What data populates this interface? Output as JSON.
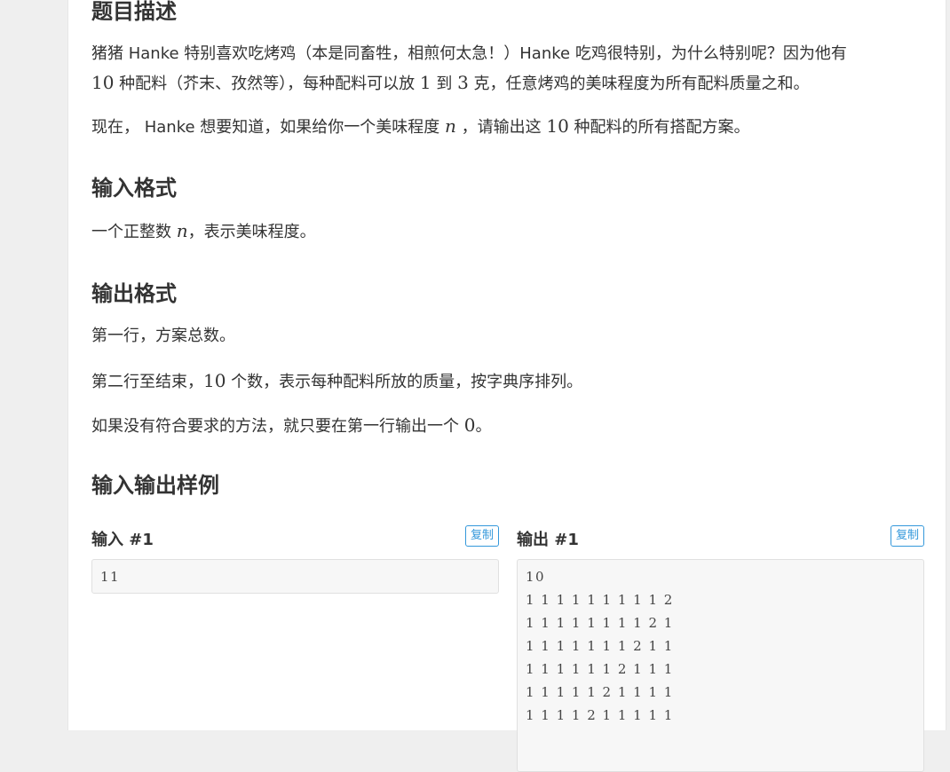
{
  "sections": {
    "description_title": "题目描述",
    "input_format_title": "输入格式",
    "output_format_title": "输出格式",
    "samples_title": "输入输出样例"
  },
  "description": {
    "p1_a": "猪猪 Hanke 特别喜欢吃烤鸡（本是同畜牲，相煎何太急！）Hanke 吃鸡很特别，为什么特别呢？因为他有",
    "p1_num10": "10",
    "p1_b": " 种配料（芥末、孜然等），每种配料可以放 ",
    "p1_num1": "1",
    "p1_c": " 到 ",
    "p1_num3": "3",
    "p1_d": " 克，任意烤鸡的美味程度为所有配料质量之和。",
    "p2_a": "现在， Hanke 想要知道，如果给你一个美味程度 ",
    "p2_var": "n",
    "p2_b": " ，请输出这 ",
    "p2_num": "10",
    "p2_c": " 种配料的所有搭配方案。"
  },
  "input_format": {
    "a": "一个正整数 ",
    "var": "n",
    "b": "，表示美味程度。"
  },
  "output_format": {
    "line1": "第一行，方案总数。",
    "line2_a": "第二行至结束，",
    "line2_num": "10",
    "line2_b": " 个数，表示每种配料所放的质量，按字典序排列。",
    "line3_a": "如果没有符合要求的方法，就只要在第一行输出一个 ",
    "line3_num": "0",
    "line3_b": "。"
  },
  "samples": {
    "input_title": "输入 #1",
    "output_title": "输出 #1",
    "copy_label": "复制",
    "input_lines": [
      "11"
    ],
    "output_lines": [
      "10",
      "1 1 1 1 1 1 1 1 1 2",
      "1 1 1 1 1 1 1 1 2 1",
      "1 1 1 1 1 1 1 2 1 1",
      "1 1 1 1 1 1 2 1 1 1",
      "1 1 1 1 1 2 1 1 1 1",
      "1 1 1 1 2 1 1 1 1 1"
    ]
  }
}
